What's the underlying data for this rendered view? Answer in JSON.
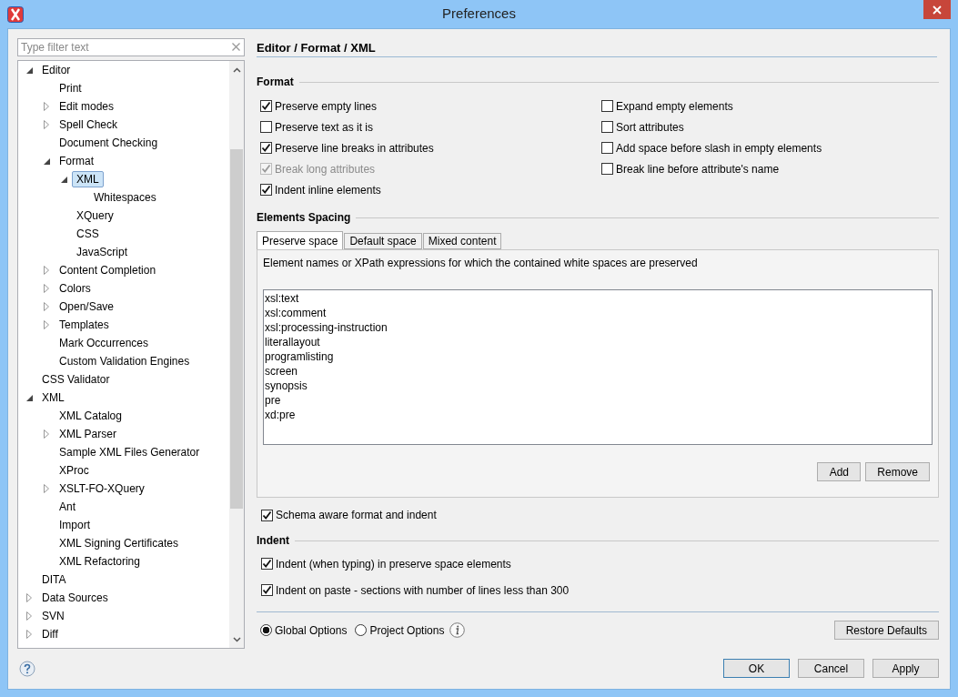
{
  "window": {
    "title": "Preferences"
  },
  "filter": {
    "placeholder": "Type filter text"
  },
  "tree": [
    {
      "label": "Editor",
      "kind": "branch",
      "expanded": true,
      "selected": false,
      "children": [
        {
          "label": "Print",
          "kind": "leaf",
          "selected": false
        },
        {
          "label": "Edit modes",
          "kind": "branch",
          "expanded": false,
          "selected": false
        },
        {
          "label": "Spell Check",
          "kind": "branch",
          "expanded": false,
          "selected": false
        },
        {
          "label": "Document Checking",
          "kind": "leaf",
          "selected": false
        },
        {
          "label": "Format",
          "kind": "branch",
          "expanded": true,
          "selected": false,
          "children": [
            {
              "label": "XML",
              "kind": "branch",
              "expanded": true,
              "selected": true,
              "children": [
                {
                  "label": "Whitespaces",
                  "kind": "leaf",
                  "selected": false
                }
              ]
            },
            {
              "label": "XQuery",
              "kind": "leaf",
              "selected": false
            },
            {
              "label": "CSS",
              "kind": "leaf",
              "selected": false
            },
            {
              "label": "JavaScript",
              "kind": "leaf",
              "selected": false
            }
          ]
        },
        {
          "label": "Content Completion",
          "kind": "branch",
          "expanded": false,
          "selected": false
        },
        {
          "label": "Colors",
          "kind": "branch",
          "expanded": false,
          "selected": false
        },
        {
          "label": "Open/Save",
          "kind": "branch",
          "expanded": false,
          "selected": false
        },
        {
          "label": "Templates",
          "kind": "branch",
          "expanded": false,
          "selected": false
        },
        {
          "label": "Mark Occurrences",
          "kind": "leaf",
          "selected": false
        },
        {
          "label": "Custom Validation Engines",
          "kind": "leaf",
          "selected": false
        }
      ]
    },
    {
      "label": "CSS Validator",
      "kind": "leaf",
      "selected": false
    },
    {
      "label": "XML",
      "kind": "branch",
      "expanded": true,
      "selected": false,
      "children": [
        {
          "label": "XML Catalog",
          "kind": "leaf",
          "selected": false
        },
        {
          "label": "XML Parser",
          "kind": "branch",
          "expanded": false,
          "selected": false
        },
        {
          "label": "Sample XML Files Generator",
          "kind": "leaf",
          "selected": false
        },
        {
          "label": "XProc",
          "kind": "leaf",
          "selected": false
        },
        {
          "label": "XSLT-FO-XQuery",
          "kind": "branch",
          "expanded": false,
          "selected": false
        },
        {
          "label": "Ant",
          "kind": "leaf",
          "selected": false
        },
        {
          "label": "Import",
          "kind": "leaf",
          "selected": false
        },
        {
          "label": "XML Signing Certificates",
          "kind": "leaf",
          "selected": false
        },
        {
          "label": "XML Refactoring",
          "kind": "leaf",
          "selected": false
        }
      ]
    },
    {
      "label": "DITA",
      "kind": "leaf",
      "selected": false
    },
    {
      "label": "Data Sources",
      "kind": "branch",
      "expanded": false,
      "selected": false
    },
    {
      "label": "SVN",
      "kind": "branch",
      "expanded": false,
      "selected": false
    },
    {
      "label": "Diff",
      "kind": "branch",
      "expanded": false,
      "selected": false
    }
  ],
  "breadcrumb": "Editor / Format / XML",
  "format_section": {
    "title": "Format",
    "left_options": [
      {
        "label": "Preserve empty lines",
        "checked": true,
        "disabled": false
      },
      {
        "label": "Preserve text as it is",
        "checked": false,
        "disabled": false
      },
      {
        "label": "Preserve line breaks in attributes",
        "checked": true,
        "disabled": false
      },
      {
        "label": "Break long attributes",
        "checked": true,
        "disabled": true
      },
      {
        "label": "Indent inline elements",
        "checked": true,
        "disabled": false
      }
    ],
    "right_options": [
      {
        "label": "Expand empty elements",
        "checked": false,
        "disabled": false
      },
      {
        "label": "Sort attributes",
        "checked": false,
        "disabled": false
      },
      {
        "label": "Add space before slash in empty elements",
        "checked": false,
        "disabled": false
      },
      {
        "label": "Break line before attribute's name",
        "checked": false,
        "disabled": false
      }
    ]
  },
  "elements_spacing": {
    "title": "Elements Spacing",
    "tabs": [
      {
        "label": "Preserve space",
        "selected": true
      },
      {
        "label": "Default space",
        "selected": false
      },
      {
        "label": "Mixed content",
        "selected": false
      }
    ],
    "description": "Element names or XPath expressions for which the contained white spaces are preserved",
    "entries": [
      "xsl:text",
      "xsl:comment",
      "xsl:processing-instruction",
      "literallayout",
      "programlisting",
      "screen",
      "synopsis",
      "pre",
      "xd:pre"
    ],
    "buttons": [
      "Add",
      "Remove"
    ]
  },
  "schema_aware": {
    "label": "Schema aware format and indent",
    "checked": true
  },
  "indent_section": {
    "title": "Indent",
    "options": [
      {
        "label": "Indent (when typing) in preserve space elements",
        "checked": true
      },
      {
        "label": "Indent on paste - sections with number of lines less than 300",
        "checked": true
      }
    ]
  },
  "scope_options": [
    {
      "label": "Global Options",
      "selected": true
    },
    {
      "label": "Project Options",
      "selected": false
    }
  ],
  "restore_button": "Restore Defaults",
  "dialog_buttons": [
    {
      "label": "OK",
      "default": true
    },
    {
      "label": "Cancel",
      "default": false
    },
    {
      "label": "Apply",
      "default": false
    }
  ]
}
